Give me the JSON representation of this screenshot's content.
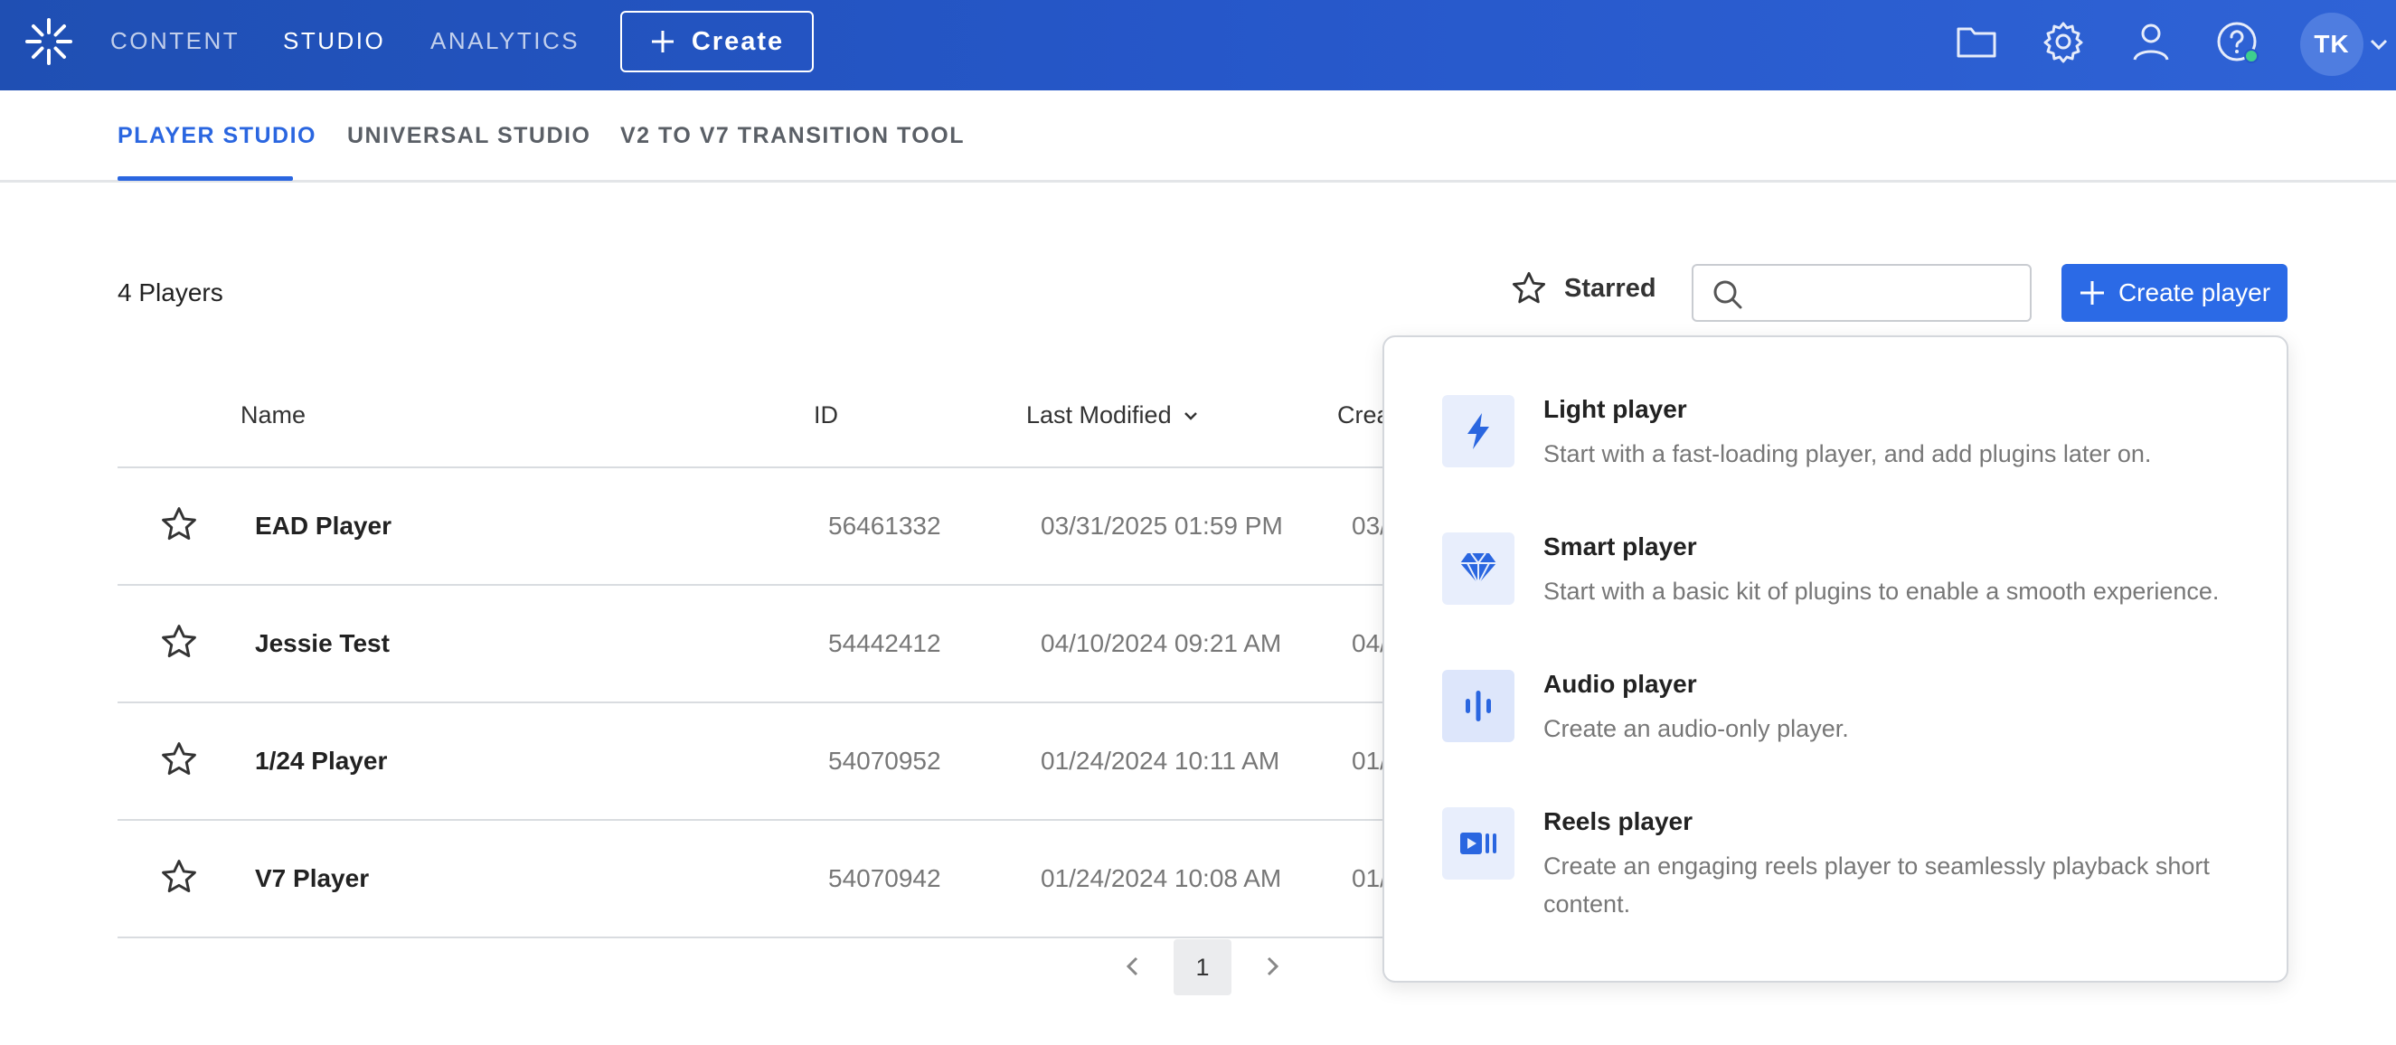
{
  "topnav": {
    "links": [
      "CONTENT",
      "STUDIO",
      "ANALYTICS"
    ],
    "active": "STUDIO",
    "create_label": "Create",
    "icons": [
      "folder-icon",
      "gear-icon",
      "user-icon",
      "help-icon"
    ],
    "avatar_initials": "TK",
    "brand_color": "#2657c9"
  },
  "subtabs": {
    "items": [
      "PLAYER STUDIO",
      "UNIVERSAL STUDIO",
      "V2 TO V7 TRANSITION TOOL"
    ],
    "active": "PLAYER STUDIO",
    "accent_color": "#2a66e0"
  },
  "toolbar": {
    "players_count": "4 Players",
    "starred_label": "Starred",
    "search_value": "",
    "create_player_label": "Create player"
  },
  "table": {
    "columns": [
      "Name",
      "ID",
      "Last Modified",
      "Crea"
    ],
    "sort_column": "Last Modified",
    "rows": [
      {
        "name": "EAD Player",
        "id": "56461332",
        "last_modified": "03/31/2025 01:59 PM",
        "created_partial": "03/"
      },
      {
        "name": "Jessie Test",
        "id": "54442412",
        "last_modified": "04/10/2024 09:21 AM",
        "created_partial": "04/"
      },
      {
        "name": "1/24 Player",
        "id": "54070952",
        "last_modified": "01/24/2024 10:11 AM",
        "created_partial": "01/"
      },
      {
        "name": "V7 Player",
        "id": "54070942",
        "last_modified": "01/24/2024 10:08 AM",
        "created_partial": "01/"
      }
    ]
  },
  "pagination": {
    "current_page": "1"
  },
  "create_menu": {
    "items": [
      {
        "icon": "lightning-icon",
        "title": "Light player",
        "description": "Start with a fast-loading player, and add plugins later on."
      },
      {
        "icon": "diamond-icon",
        "title": "Smart player",
        "description": "Start with a basic kit of plugins to enable a smooth experience."
      },
      {
        "icon": "audio-bars-icon",
        "title": "Audio player",
        "description": "Create an audio-only player."
      },
      {
        "icon": "reels-icon",
        "title": "Reels player",
        "description": "Create an engaging reels player to seamlessly playback short content."
      }
    ]
  }
}
